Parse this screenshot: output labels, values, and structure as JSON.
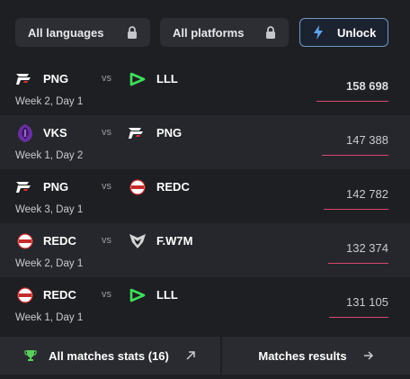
{
  "filters": {
    "languages_label": "All languages",
    "platforms_label": "All platforms",
    "unlock_label": "Unlock"
  },
  "matches": [
    {
      "team1": "PNG",
      "team2": "LLL",
      "vs": "vs",
      "round": "Week 2, Day 1",
      "views": "158 698",
      "views_fraction": 1.0
    },
    {
      "team1": "VKS",
      "team2": "PNG",
      "vs": "vs",
      "round": "Week 1, Day 2",
      "views": "147 388",
      "views_fraction": 0.929
    },
    {
      "team1": "PNG",
      "team2": "REDC",
      "vs": "vs",
      "round": "Week 3, Day 1",
      "views": "142 782",
      "views_fraction": 0.9
    },
    {
      "team1": "REDC",
      "team2": "F.W7M",
      "vs": "vs",
      "round": "Week 2, Day 1",
      "views": "132 374",
      "views_fraction": 0.834
    },
    {
      "team1": "REDC",
      "team2": "LLL",
      "vs": "vs",
      "round": "Week 1, Day 1",
      "views": "131 105",
      "views_fraction": 0.826
    }
  ],
  "footer": {
    "stats_label": "All matches stats (16)",
    "results_label": "Matches results"
  },
  "colors": {
    "accent_bar": "#d9466f",
    "unlock_border": "#6f9ac8",
    "trophy": "#59d05c",
    "lll_green": "#3ee05a"
  }
}
